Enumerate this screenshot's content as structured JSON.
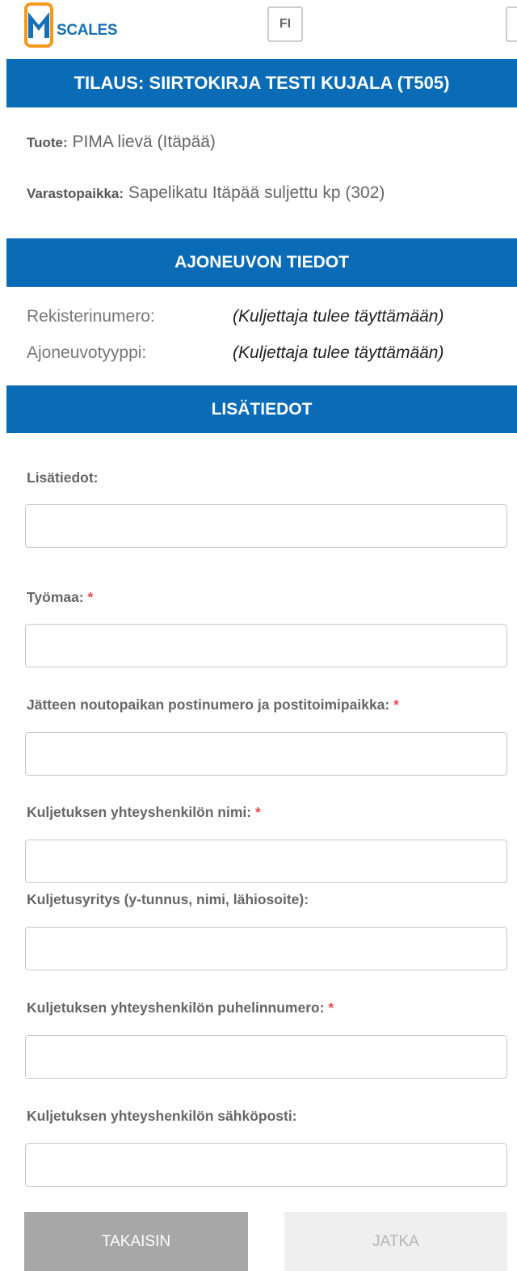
{
  "header": {
    "logo_text": "SCALES",
    "language": "FI"
  },
  "order": {
    "title": "TILAUS: SIIRTOKIRJA TESTI KUJALA (T505)",
    "product_label": "Tuote:",
    "product_value": "PIMA lievä (Itäpää)",
    "storage_label": "Varastopaikka:",
    "storage_value": "Sapelikatu Itäpää suljettu kp (302)"
  },
  "vehicle": {
    "title": "AJONEUVON TIEDOT",
    "rows": [
      {
        "label": "Rekisterinumero:",
        "value": "(Kuljettaja tulee täyttämään)"
      },
      {
        "label": "Ajoneuvotyyppi:",
        "value": "(Kuljettaja tulee täyttämään)"
      }
    ]
  },
  "extra": {
    "title": "LISÄTIEDOT",
    "fields": [
      {
        "label": "Lisätiedot:",
        "required": false,
        "value": ""
      },
      {
        "label": "Työmaa:",
        "required": true,
        "value": ""
      },
      {
        "label": "Jätteen noutopaikan postinumero ja postitoimipaikka:",
        "required": true,
        "value": ""
      },
      {
        "label": "Kuljetuksen yhteyshenkilön nimi:",
        "required": true,
        "value": ""
      },
      {
        "label": "Kuljetusyritys (y-tunnus, nimi, lähiosoite):",
        "required": false,
        "value": ""
      },
      {
        "label": "Kuljetuksen yhteyshenkilön puhelinnumero:",
        "required": true,
        "value": ""
      },
      {
        "label": "Kuljetuksen yhteyshenkilön sähköposti:",
        "required": false,
        "value": ""
      }
    ],
    "required_mark": "*"
  },
  "actions": {
    "back_label": "TAKAISIN",
    "next_label": "JATKA"
  },
  "colors": {
    "primary": "#0a6bb7",
    "logo_orange": "#f39a1e",
    "required": "#e05050",
    "button_back": "#a7a7a7",
    "button_disabled": "#efefef"
  }
}
